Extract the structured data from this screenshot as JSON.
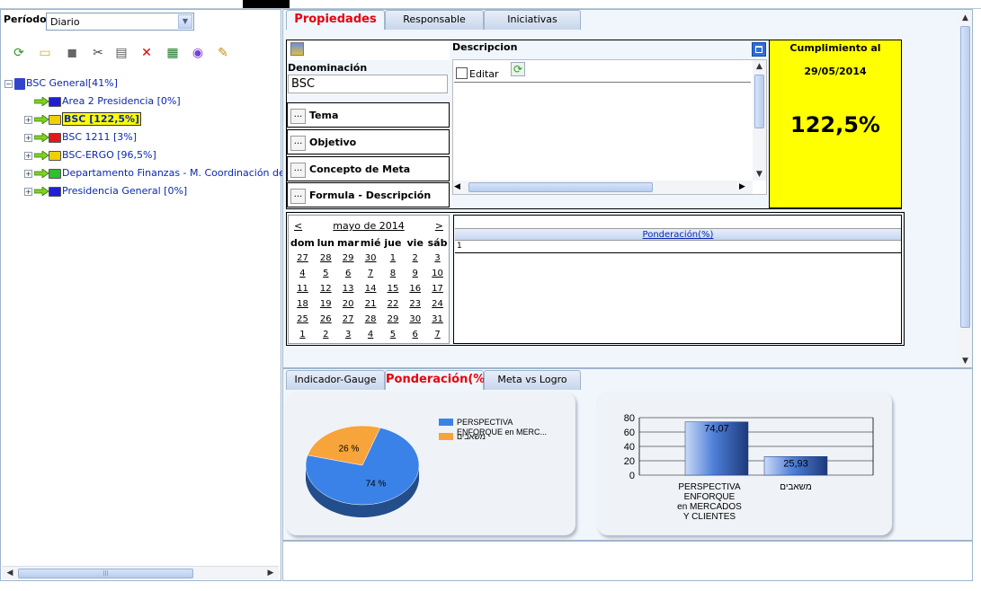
{
  "period": {
    "label": "Período:",
    "value": "Diario"
  },
  "toolbar_icons": [
    "refresh-icon",
    "folder-icon",
    "stack-icon",
    "cut-icon",
    "paste-icon",
    "delete-icon",
    "excel-icon",
    "globe-icon",
    "notes-icon"
  ],
  "tree": {
    "root": "BSC General[41%]",
    "items": [
      {
        "label": "Area 2 Presidencia [0%]",
        "folder_color": "#1f1fd6",
        "expandable": false
      },
      {
        "label": "BSC [122,5%]",
        "folder_color": "#f0d000",
        "expandable": true,
        "selected": true
      },
      {
        "label": "BSC 1211 [3%]",
        "folder_color": "#e01a1a",
        "expandable": true
      },
      {
        "label": "BSC-ERGO [96,5%]",
        "folder_color": "#f0d000",
        "expandable": true
      },
      {
        "label": "Departamento Finanzas - M. Coordinación de Secto",
        "folder_color": "#2fbf2f",
        "expandable": true
      },
      {
        "label": "Presidencia General [0%]",
        "folder_color": "#1f1fd6",
        "expandable": true
      }
    ]
  },
  "top_tabs": [
    "Propiedades",
    "Responsable",
    "Iniciativas"
  ],
  "properties": {
    "denominacion_label": "Denominación",
    "denominacion_value": "BSC",
    "fields": [
      "Tema",
      "Objetivo",
      "Concepto de Meta",
      "Formula - Descripción"
    ],
    "field_button": "...",
    "descripcion_label": "Descripcion",
    "editar_label": "Editar",
    "cumplimiento_title": "Cumplimiento al",
    "cumplimiento_date": "29/05/2014",
    "cumplimiento_value": "122,5%"
  },
  "calendar": {
    "prev": "<",
    "next": ">",
    "month": "mayo de 2014",
    "days": [
      "dom",
      "lun",
      "mar",
      "mié",
      "jue",
      "vie",
      "sáb"
    ],
    "weeks": [
      [
        "27",
        "28",
        "29",
        "30",
        "1",
        "2",
        "3"
      ],
      [
        "4",
        "5",
        "6",
        "7",
        "8",
        "9",
        "10"
      ],
      [
        "11",
        "12",
        "13",
        "14",
        "15",
        "16",
        "17"
      ],
      [
        "18",
        "19",
        "20",
        "21",
        "22",
        "23",
        "24"
      ],
      [
        "25",
        "26",
        "27",
        "28",
        "29",
        "30",
        "31"
      ],
      [
        "1",
        "2",
        "3",
        "4",
        "5",
        "6",
        "7"
      ]
    ]
  },
  "ponderacion_grid": {
    "header": "Ponderación(%)",
    "row1": "1"
  },
  "bottom_tabs": [
    "Indicador-Gauge",
    "Ponderación(%)",
    "Meta vs Logro"
  ],
  "chart_data": [
    {
      "type": "pie",
      "labels": [
        "PERSPECTIVA ENFORQUE  en MERC...",
        "משאבים"
      ],
      "values": [
        74,
        26
      ],
      "value_labels": [
        "74 %",
        "26 %"
      ],
      "colors": [
        "#3b82e8",
        "#f7a43a"
      ],
      "legend": "right"
    },
    {
      "type": "bar",
      "categories": [
        "PERSPECTIVA ENFORQUE en MERCADOS Y CLIENTES",
        "משאבים"
      ],
      "category_lines": [
        [
          "PERSPECTIVA",
          "ENFORQUE",
          "en MERCADOS",
          "Y CLIENTES"
        ],
        [
          "משאבים"
        ]
      ],
      "values": [
        74.07,
        25.93
      ],
      "value_labels": [
        "74,07",
        "25,93"
      ],
      "ylim": [
        0,
        80
      ],
      "yticks": [
        "0",
        "20",
        "40",
        "60",
        "80"
      ],
      "grid": true
    }
  ]
}
